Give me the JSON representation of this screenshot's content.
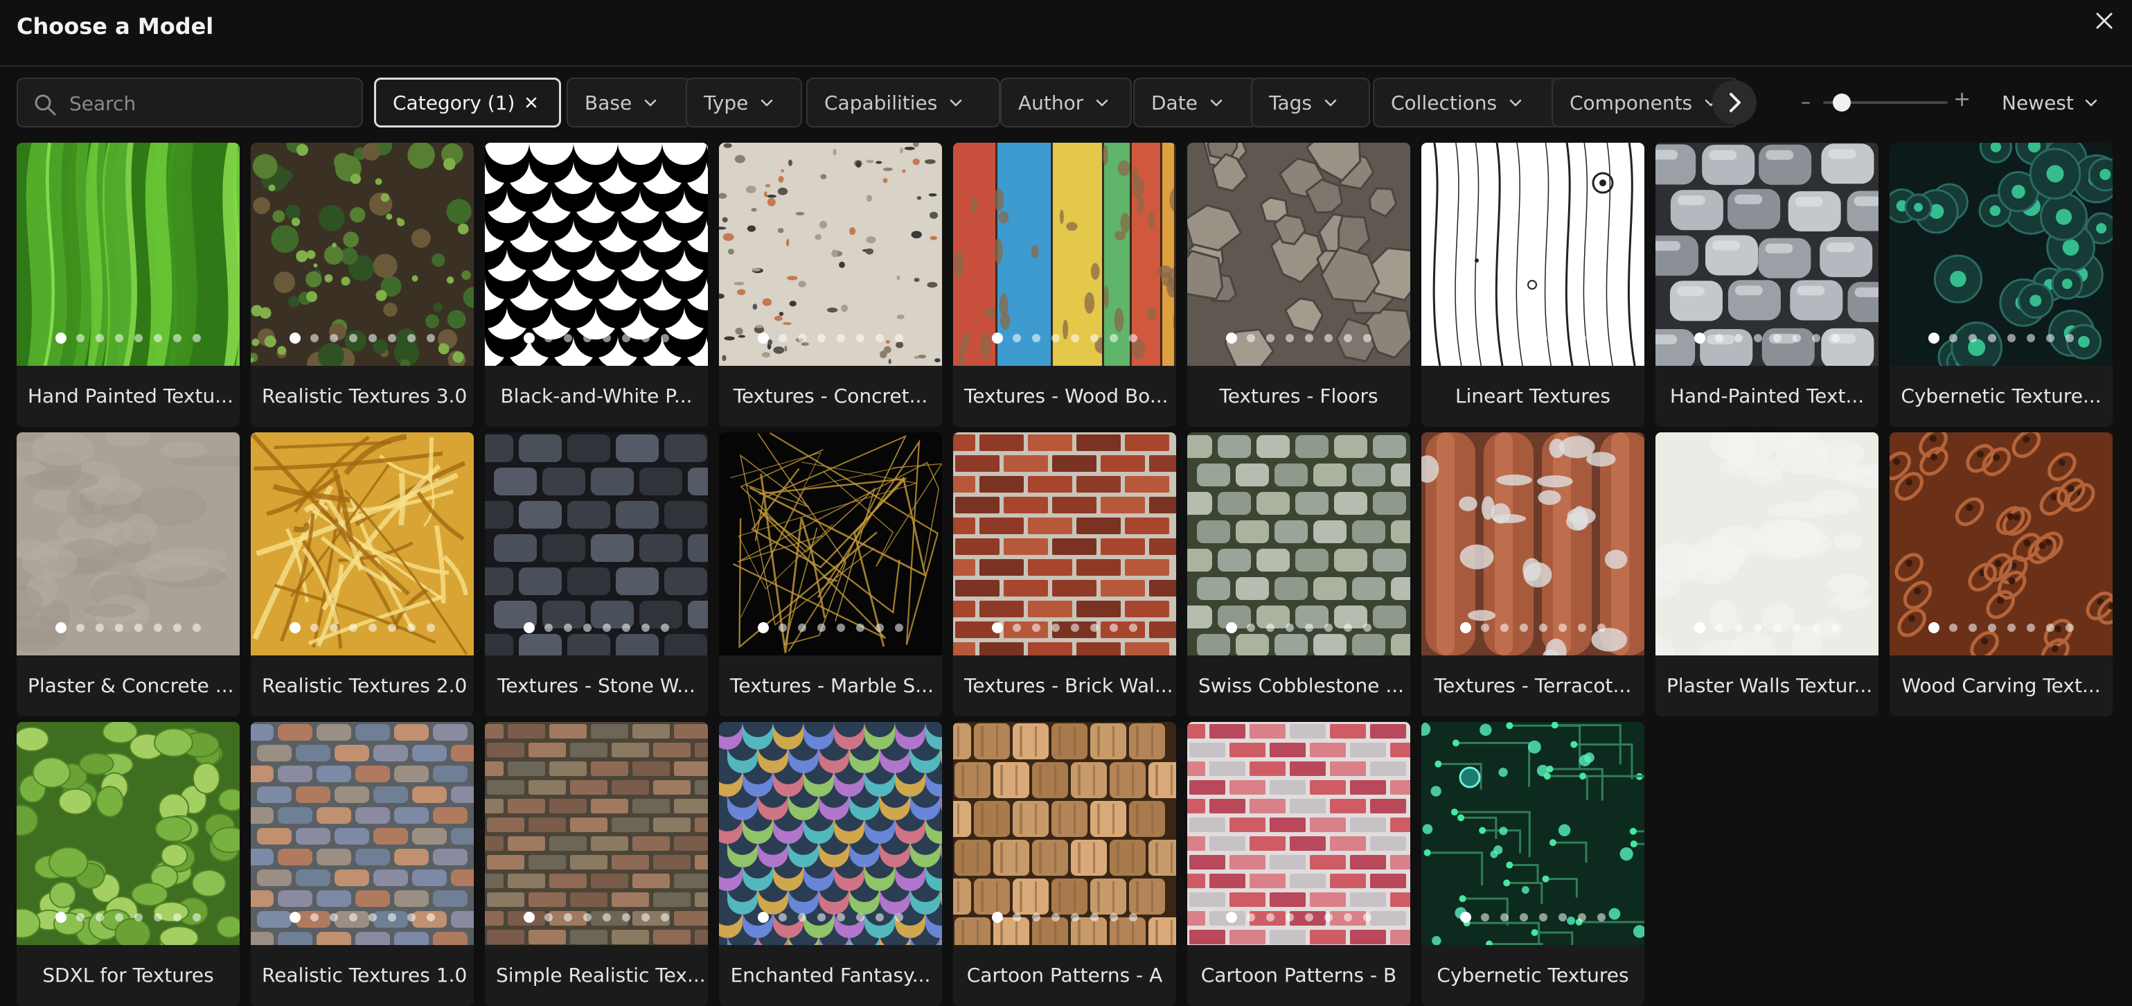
{
  "modal": {
    "title": "Choose a Model"
  },
  "toolbar": {
    "search_placeholder": "Search",
    "category_label": "Category (1)",
    "filters": [
      "Base",
      "Type",
      "Capabilities",
      "Author",
      "Date",
      "Tags",
      "Collections",
      "Components"
    ],
    "sort_label": "Newest",
    "zoom_minus": "–",
    "zoom_plus": "+",
    "zoom_level": 0.15
  },
  "models": [
    {
      "label": "Hand Painted Textu...",
      "texture": "grass"
    },
    {
      "label": "Realistic Textures 3.0",
      "texture": "moss"
    },
    {
      "label": "Black-and-White P...",
      "texture": "scales_bw"
    },
    {
      "label": "Textures - Concret...",
      "texture": "terrazzo"
    },
    {
      "label": "Textures - Wood Bo...",
      "texture": "wood_boards"
    },
    {
      "label": "Textures - Floors",
      "texture": "flagstone"
    },
    {
      "label": "Lineart Textures",
      "texture": "lineart"
    },
    {
      "label": "Hand-Painted Text...",
      "texture": "grey_stones"
    },
    {
      "label": "Cybernetic Texture...",
      "texture": "cyber_orbs"
    },
    {
      "label": "Plaster & Concrete ...",
      "texture": "plaster"
    },
    {
      "label": "Realistic Textures 2.0",
      "texture": "gold_foil"
    },
    {
      "label": "Textures - Stone W...",
      "texture": "stone_wall"
    },
    {
      "label": "Textures - Marble S...",
      "texture": "marble"
    },
    {
      "label": "Textures - Brick Wal...",
      "texture": "brick"
    },
    {
      "label": "Swiss Cobblestone ...",
      "texture": "cobble"
    },
    {
      "label": "Textures - Terracot...",
      "texture": "terracotta"
    },
    {
      "label": "Plaster Walls Textur...",
      "texture": "white_plaster"
    },
    {
      "label": "Wood Carving Text...",
      "texture": "wood_carving"
    },
    {
      "label": "SDXL for Textures",
      "texture": "leaves"
    },
    {
      "label": "Realistic Textures 1.0",
      "texture": "colored_stones"
    },
    {
      "label": "Simple Realistic Tex...",
      "texture": "old_brick"
    },
    {
      "label": "Enchanted Fantasy...",
      "texture": "iridescent"
    },
    {
      "label": "Cartoon Patterns - A",
      "texture": "wood_shingles"
    },
    {
      "label": "Cartoon Patterns - B",
      "texture": "pink_brick"
    },
    {
      "label": "Cybernetic Textures",
      "texture": "circuit"
    }
  ]
}
